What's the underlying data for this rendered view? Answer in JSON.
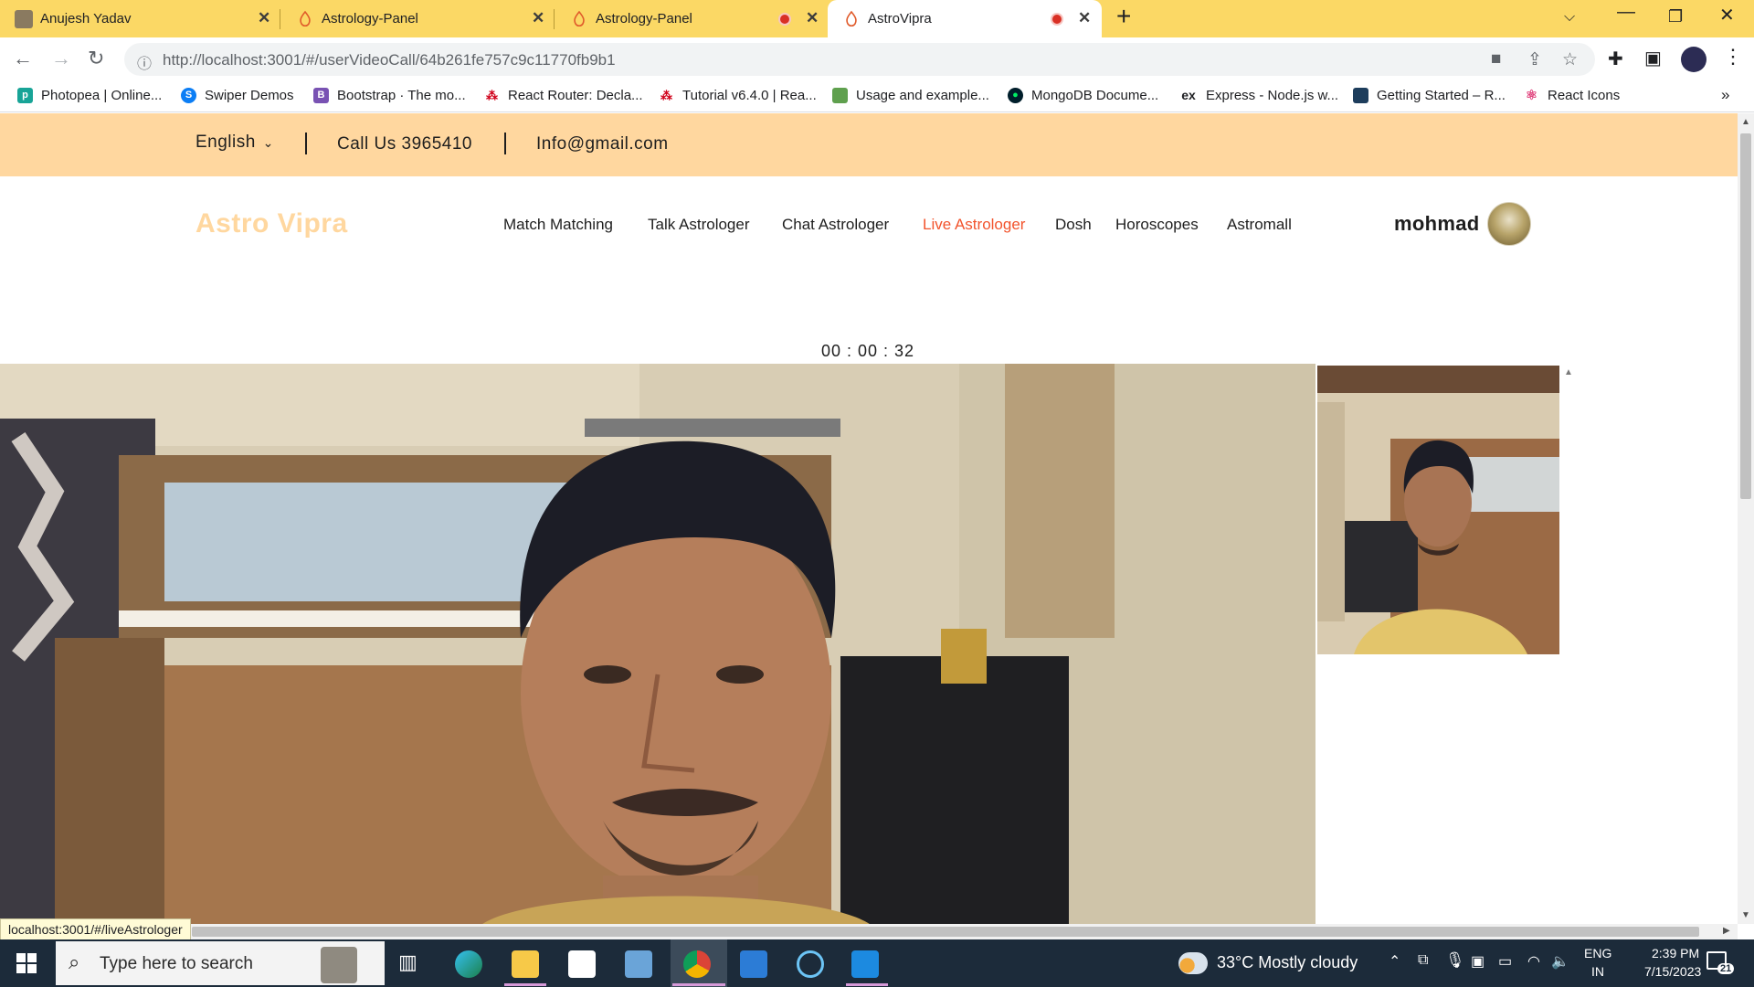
{
  "browser": {
    "tabs": [
      {
        "title": "Anujesh Yadav"
      },
      {
        "title": "Astrology-Panel"
      },
      {
        "title": "Astrology-Panel"
      },
      {
        "title": "AstroVipra"
      }
    ],
    "url": "http://localhost:3001/#/userVideoCall/64b261fe757c9c11770fb9b1",
    "bookmarks": [
      "Photopea | Online...",
      "Swiper Demos",
      "Bootstrap · The mo...",
      "React Router: Decla...",
      "Tutorial v6.4.0 | Rea...",
      "Usage and example...",
      "MongoDB Docume...",
      "Express - Node.js w...",
      "Getting Started – R...",
      "React Icons"
    ],
    "status_url": "localhost:3001/#/liveAstrologer"
  },
  "site": {
    "topbar": {
      "language": "English",
      "phone": "Call Us 3965410",
      "email": "Info@gmail.com"
    },
    "brand": "Astro Vipra",
    "menu": [
      "Match Matching",
      "Talk Astrologer",
      "Chat Astrologer",
      "Live Astrologer",
      "Dosh",
      "Horoscopes",
      "Astromall"
    ],
    "active_menu": "Live Astrologer",
    "username": "mohmad",
    "call_timer": "00 : 00 : 32"
  },
  "taskbar": {
    "search_placeholder": "Type here to search",
    "weather": "33°C  Mostly cloudy",
    "lang_top": "ENG",
    "lang_bottom": "IN",
    "time": "2:39 PM",
    "date": "7/15/2023",
    "notifications": "21"
  },
  "colors": {
    "tabstrip": "#fbd865",
    "topbar": "#ffd79f",
    "brand": "#ffd79f",
    "active_menu": "#f2542d",
    "taskbar": "#1c2b3a"
  }
}
